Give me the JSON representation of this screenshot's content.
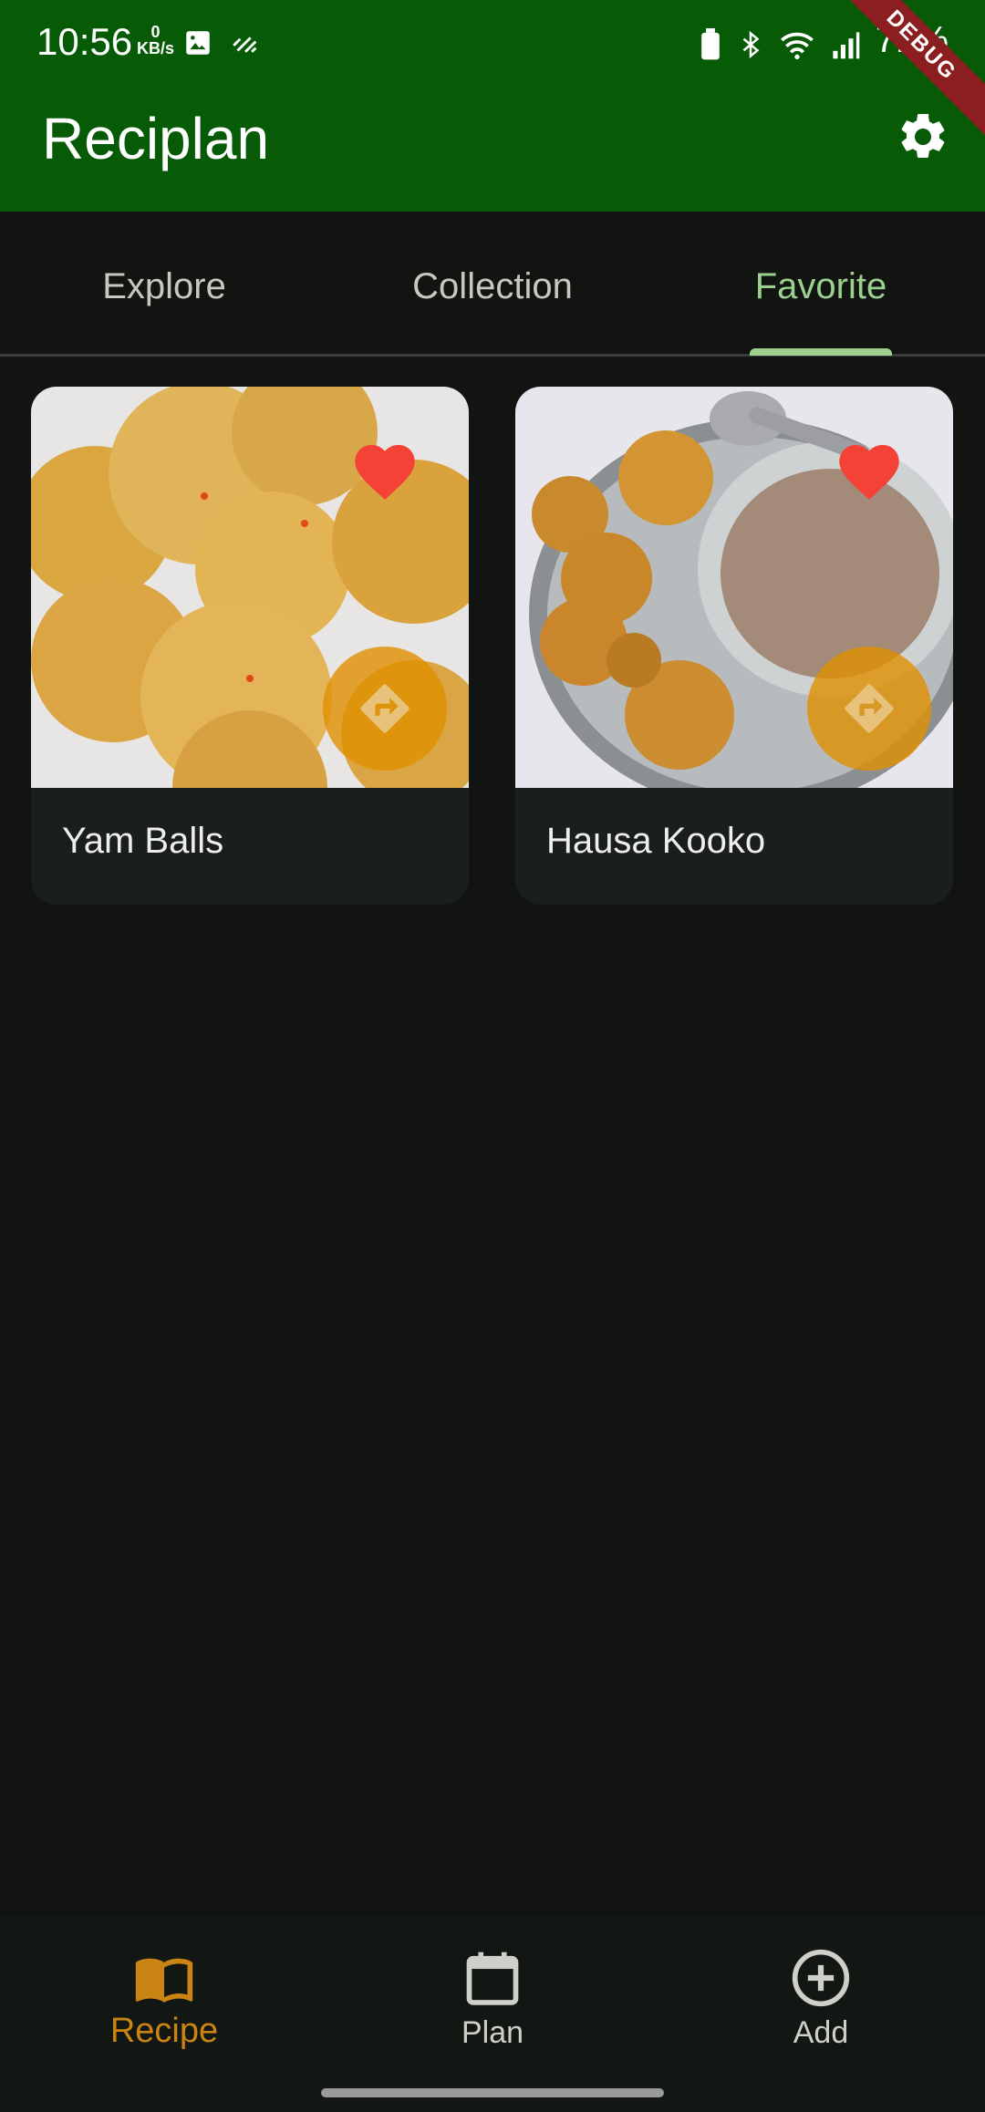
{
  "status_bar": {
    "time": "10:56",
    "net_speed_value": "0",
    "net_speed_unit": "KB/s",
    "battery": "71%",
    "debug_label": "DEBUG"
  },
  "app_bar": {
    "title": "Reciplan",
    "settings_icon": "gear-icon"
  },
  "tabs": [
    {
      "label": "Explore",
      "active": false
    },
    {
      "label": "Collection",
      "active": false
    },
    {
      "label": "Favorite",
      "active": true
    }
  ],
  "recipes": [
    {
      "title": "Yam Balls",
      "favorited": true
    },
    {
      "title": "Hausa Kooko",
      "favorited": true
    }
  ],
  "bottom_nav": [
    {
      "label": "Recipe",
      "icon": "book-icon",
      "active": true
    },
    {
      "label": "Plan",
      "icon": "calendar-icon",
      "active": false
    },
    {
      "label": "Add",
      "icon": "add-circle-icon",
      "active": false
    }
  ],
  "colors": {
    "app_bar": "#075b07",
    "background": "#111411",
    "tab_active": "#9bd08f",
    "accent_orange": "#c98413",
    "heart_red": "#f44336"
  }
}
